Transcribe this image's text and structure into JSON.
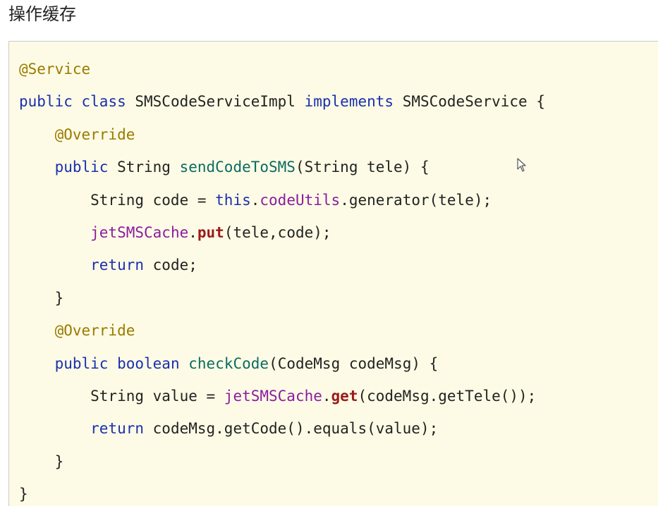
{
  "heading": "操作缓存",
  "code": {
    "lines": [
      [
        {
          "t": "@Service",
          "c": "annotation"
        }
      ],
      [
        {
          "t": "public",
          "c": "keyword"
        },
        {
          "t": " ",
          "c": "plain"
        },
        {
          "t": "class",
          "c": "keyword"
        },
        {
          "t": " SMSCodeServiceImpl ",
          "c": "plain"
        },
        {
          "t": "implements",
          "c": "keyword"
        },
        {
          "t": " SMSCodeService {",
          "c": "plain"
        }
      ],
      [
        {
          "t": "    ",
          "c": "plain"
        },
        {
          "t": "@Override",
          "c": "annotation"
        }
      ],
      [
        {
          "t": "    ",
          "c": "plain"
        },
        {
          "t": "public",
          "c": "keyword"
        },
        {
          "t": " String ",
          "c": "plain"
        },
        {
          "t": "sendCodeToSMS",
          "c": "method"
        },
        {
          "t": "(String tele) {",
          "c": "plain"
        }
      ],
      [
        {
          "t": "        String code = ",
          "c": "plain"
        },
        {
          "t": "this",
          "c": "keyword"
        },
        {
          "t": ".",
          "c": "plain"
        },
        {
          "t": "codeUtils",
          "c": "field"
        },
        {
          "t": ".generator(tele);",
          "c": "plain"
        }
      ],
      [
        {
          "t": "        ",
          "c": "plain"
        },
        {
          "t": "jetSMSCache",
          "c": "field"
        },
        {
          "t": ".",
          "c": "plain"
        },
        {
          "t": "put",
          "c": "call"
        },
        {
          "t": "(tele,code);",
          "c": "plain"
        }
      ],
      [
        {
          "t": "        ",
          "c": "plain"
        },
        {
          "t": "return",
          "c": "keyword"
        },
        {
          "t": " code;",
          "c": "plain"
        }
      ],
      [
        {
          "t": "    }",
          "c": "plain"
        }
      ],
      [
        {
          "t": "    ",
          "c": "plain"
        },
        {
          "t": "@Override",
          "c": "annotation"
        }
      ],
      [
        {
          "t": "    ",
          "c": "plain"
        },
        {
          "t": "public",
          "c": "keyword"
        },
        {
          "t": " ",
          "c": "plain"
        },
        {
          "t": "boolean",
          "c": "keyword"
        },
        {
          "t": " ",
          "c": "plain"
        },
        {
          "t": "checkCode",
          "c": "method"
        },
        {
          "t": "(CodeMsg codeMsg) {",
          "c": "plain"
        }
      ],
      [
        {
          "t": "        String value = ",
          "c": "plain"
        },
        {
          "t": "jetSMSCache",
          "c": "field"
        },
        {
          "t": ".",
          "c": "plain"
        },
        {
          "t": "get",
          "c": "call"
        },
        {
          "t": "(codeMsg.getTele());",
          "c": "plain"
        }
      ],
      [
        {
          "t": "        ",
          "c": "plain"
        },
        {
          "t": "return",
          "c": "keyword"
        },
        {
          "t": " codeMsg.getCode().equals(value);",
          "c": "plain"
        }
      ],
      [
        {
          "t": "    }",
          "c": "plain"
        }
      ],
      [
        {
          "t": "}",
          "c": "plain"
        }
      ]
    ]
  },
  "colors": {
    "background": "#fdfbe5",
    "annotation": "#9a7a00",
    "keyword": "#1a2fb0",
    "method": "#0b6b63",
    "field": "#8a1ca0",
    "call": "#9b1b1b"
  },
  "cursor_icon": "mouse-pointer-icon"
}
